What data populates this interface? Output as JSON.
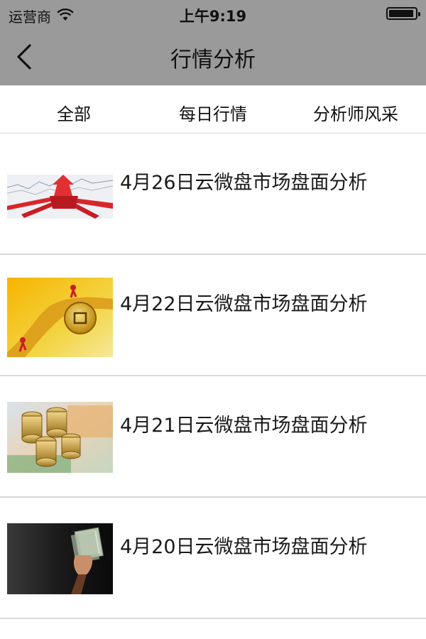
{
  "status_bar": {
    "carrier": "运营商",
    "time": "上午9:19",
    "wifi_icon": "wifi-icon",
    "battery_icon": "battery-icon"
  },
  "nav": {
    "title": "行情分析",
    "back_icon": "chevron-left-icon"
  },
  "tabs": [
    {
      "label": "全部"
    },
    {
      "label": "每日行情"
    },
    {
      "label": "分析师风采"
    }
  ],
  "articles": [
    {
      "title": "4月26日云微盘市场盘面分析",
      "thumbnail": "market-arrows-image"
    },
    {
      "title": "4月22日云微盘市场盘面分析",
      "thumbnail": "gold-coin-road-image"
    },
    {
      "title": "4月21日云微盘市场盘面分析",
      "thumbnail": "coins-banknotes-image"
    },
    {
      "title": "4月20日云微盘市场盘面分析",
      "thumbnail": "hand-holding-money-image"
    }
  ],
  "colors": {
    "header_bg": "#9a9a9a",
    "divider": "#d9d9d9",
    "text": "#1a1a1a"
  }
}
